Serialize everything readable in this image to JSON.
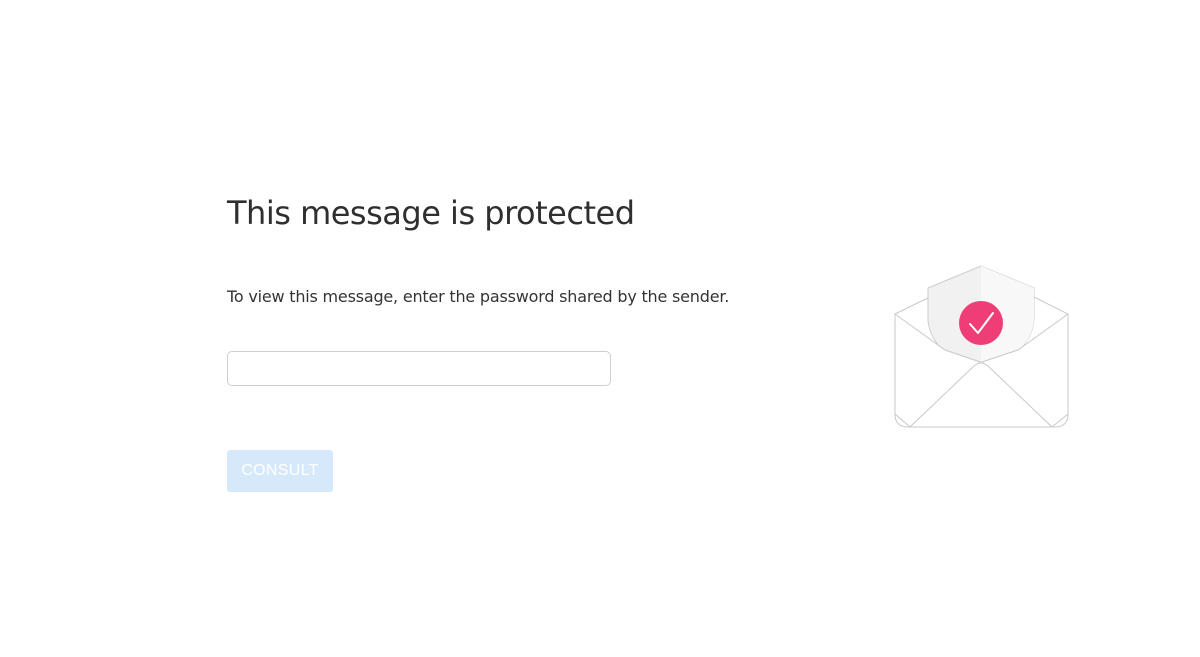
{
  "page": {
    "title": "This message is protected",
    "instruction": "To view this message, enter the password shared by the sender."
  },
  "password_field": {
    "value": "",
    "placeholder": ""
  },
  "consult_button": {
    "label": "CONSULT",
    "disabled": true
  },
  "illustration": {
    "icon": "protected-envelope-icon",
    "badge_icon": "checkmark-icon",
    "badge_color": "#ee3d77",
    "button_color": "#d5e9fb"
  }
}
